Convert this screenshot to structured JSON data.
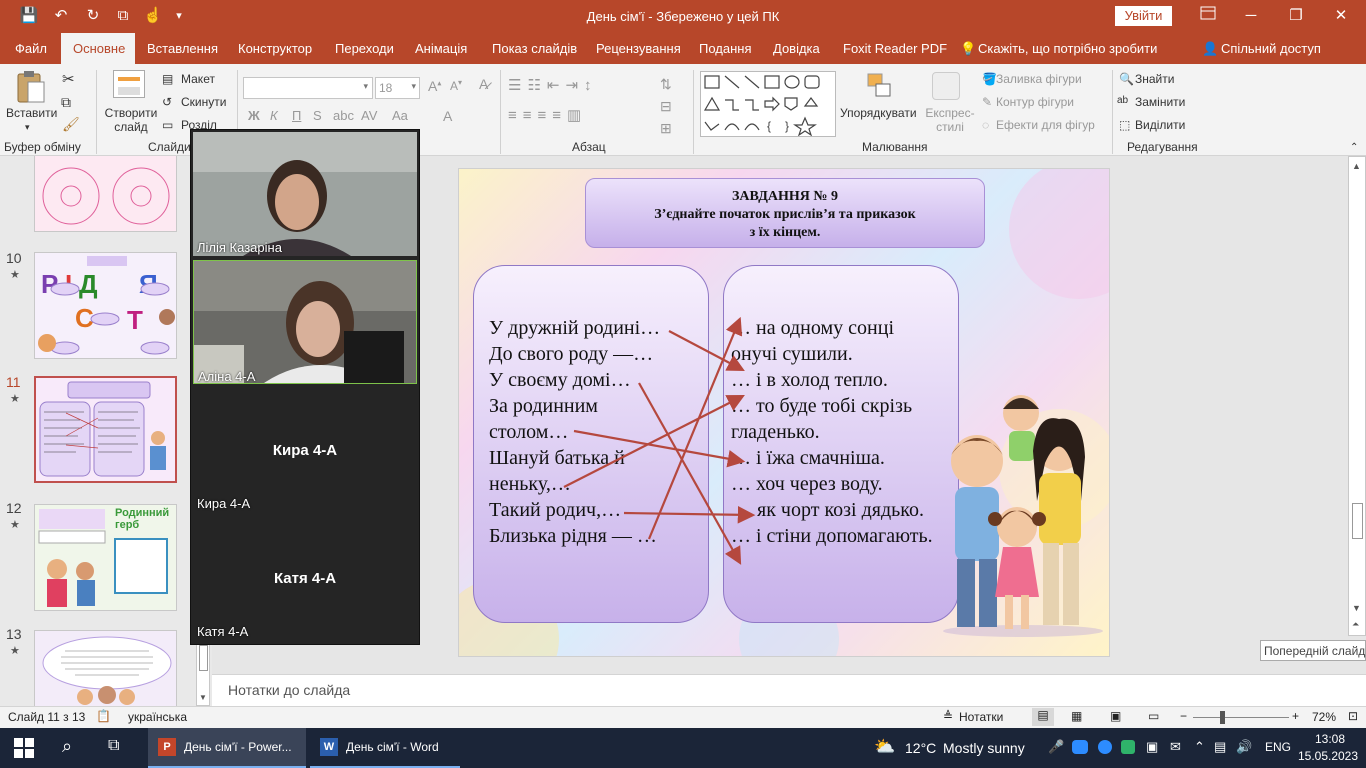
{
  "app": {
    "doc_title": "День сім'ї - Збережено у цей ПК",
    "signin": "Увійти"
  },
  "window_controls": {
    "minimize": "─",
    "restore": "❐",
    "close": "✕"
  },
  "quick_access": {
    "save": "💾",
    "undo": "↶",
    "redo": "↻",
    "present": "⧉",
    "touch": "☝",
    "more": "▾"
  },
  "menu": {
    "file": "Файл",
    "home": "Основне",
    "insert": "Вставлення",
    "design": "Конструктор",
    "transitions": "Переходи",
    "animation": "Анімація",
    "slideshow": "Показ слайдів",
    "review": "Рецензування",
    "view": "Подання",
    "help": "Довідка",
    "foxit": "Foxit Reader PDF",
    "tell": "Скажіть, що потрібно зробити",
    "share": "Спільний доступ"
  },
  "ribbon": {
    "clipboard": {
      "paste": "Вставити",
      "label": "Буфер обміну"
    },
    "slides": {
      "new_slide": "Створити слайд",
      "layout": "Макет",
      "reset": "Скинути",
      "section": "Розділ",
      "label": "Слайди"
    },
    "font": {
      "size": "18",
      "bold": "Ж",
      "italic": "К",
      "underline": "П",
      "strike": "S"
    },
    "paragraph": {
      "label": "Абзац"
    },
    "drawing": {
      "arrange": "Упорядкувати",
      "quick_styles": "Експрес-стилі",
      "fill": "Заливка фігури",
      "outline": "Контур фігури",
      "effects": "Ефекти для фігур",
      "label": "Малювання"
    },
    "editing": {
      "find": "Знайти",
      "replace": "Замінити",
      "select": "Виділити",
      "label": "Редагування"
    }
  },
  "thumbnails": [
    {
      "num": "10",
      "star": "★"
    },
    {
      "num": "11",
      "star": "★"
    },
    {
      "num": "12",
      "star": "★"
    },
    {
      "num": "13",
      "star": "★"
    }
  ],
  "thumb_text": {
    "t12_title": "Родинний герб"
  },
  "slide": {
    "title1": "ЗАВДАННЯ № 9",
    "title2": "З’єднайте початок прислів’я та приказок",
    "title3": "з їх кінцем.",
    "left": [
      "У дружній родині…",
      "До свого роду —…",
      "У своєму домі…",
      "За родинним",
      "столом…",
      "Шануй батька й",
      "неньку,…",
      "Такий родич,…",
      "Близька рідня — …"
    ],
    "right": [
      "… на одному сонці",
      "онучі сушили.",
      "… і в холод тепло.",
      "…  то буде тобі скрізь",
      "гладенько.",
      "… і їжа смачніша.",
      "… хоч через воду.",
      "як чорт козі дядько.",
      "… і стіни допомагають."
    ]
  },
  "video": {
    "p1": "Лілія Казаріна",
    "p2": "Аліна 4-А",
    "p3_center": "Кира 4-А",
    "p3": "Кира 4-А",
    "p4_center": "Катя  4-А",
    "p4": "Катя  4-А"
  },
  "tooltip": "Попередній слайд",
  "notes_placeholder": "Нотатки до слайда",
  "status": {
    "slide": "Слайд 11 з 13",
    "lang": "українська",
    "notes": "Нотатки",
    "zoom": "72%"
  },
  "taskbar": {
    "ppt": "День сім'ї - Power...",
    "word": "День сім'ї - Word",
    "temp": "12°C",
    "weather": "Mostly sunny",
    "lang": "ENG",
    "time": "13:08",
    "date": "15.05.2023"
  },
  "colors": {
    "accent": "#b7472a",
    "taskbar": "#1b2538"
  }
}
